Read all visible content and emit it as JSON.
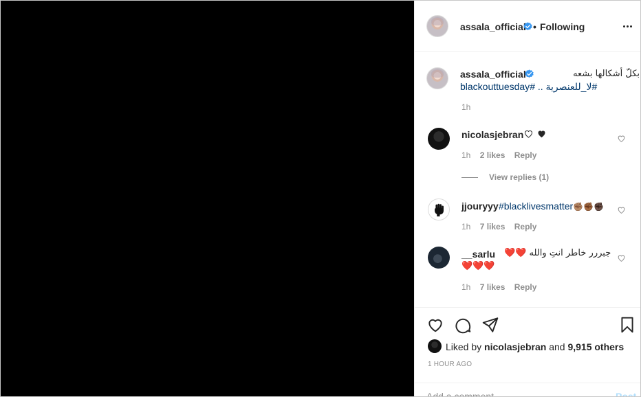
{
  "header": {
    "username": "assala_official",
    "bullet": "•",
    "follow_status": "Following"
  },
  "caption": {
    "username": "assala_official",
    "text_arabic": "بكلّ أشكالها بشعه",
    "hashtag_line": "#لا_للعنصرية .. #blackouttuesday",
    "time": "1h"
  },
  "comments": [
    {
      "username": "nicolasjebran",
      "text": "🤍🖤",
      "time": "1h",
      "likes": "2 likes",
      "reply": "Reply"
    },
    {
      "username": "jjouryyy",
      "text": "#blacklivesmatter",
      "emoji": "✊🏽✊🏾✊🏿",
      "time": "1h",
      "likes": "7 likes",
      "reply": "Reply"
    },
    {
      "username": "__sarlu",
      "text": "جبررر خاطر انتِ والله ❤️❤️",
      "emoji": "❤️❤️❤️",
      "time": "1h",
      "likes": "7 likes",
      "reply": "Reply"
    }
  ],
  "view_replies": "View replies (1)",
  "likes_line": {
    "prefix": "Liked by",
    "user": "nicolasjebran",
    "and": "and",
    "count": "9,915 others"
  },
  "timestamp": "1 hour ago",
  "comment_box": {
    "placeholder": "Add a comment…",
    "post_label": "Post"
  },
  "colors": {
    "link": "#00376b",
    "verified": "#3897f0",
    "meta": "#8e8e8e",
    "post_disabled": "#b2dffc",
    "media_bg": "#000000"
  },
  "icons": [
    "more-icon",
    "verified-badge-icon",
    "heart-icon",
    "comment-icon",
    "share-icon",
    "bookmark-icon"
  ]
}
